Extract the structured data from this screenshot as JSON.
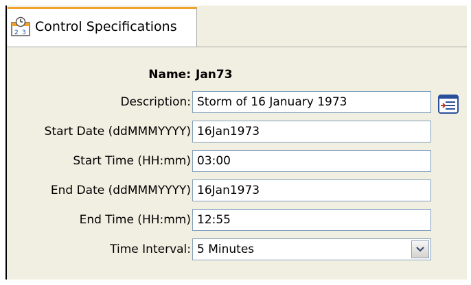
{
  "tab": {
    "label": "Control Specifications",
    "icon": "clock-calendar-icon"
  },
  "form": {
    "name_label": "Name:",
    "name_value": "Jan73",
    "description_label": "Description:",
    "description_value": "Storm of 16 January 1973",
    "start_date_label": "Start Date (ddMMMYYYY)",
    "start_date_value": "16Jan1973",
    "start_time_label": "Start Time (HH:mm)",
    "start_time_value": "03:00",
    "end_date_label": "End Date (ddMMMYYYY)",
    "end_date_value": "16Jan1973",
    "end_time_label": "End Time (HH:mm)",
    "end_time_value": "12:55",
    "time_interval_label": "Time Interval:",
    "time_interval_value": "5 Minutes"
  },
  "colors": {
    "accent": "#f0a22a",
    "panel": "#f1efe2",
    "field_border": "#7f9db9"
  }
}
